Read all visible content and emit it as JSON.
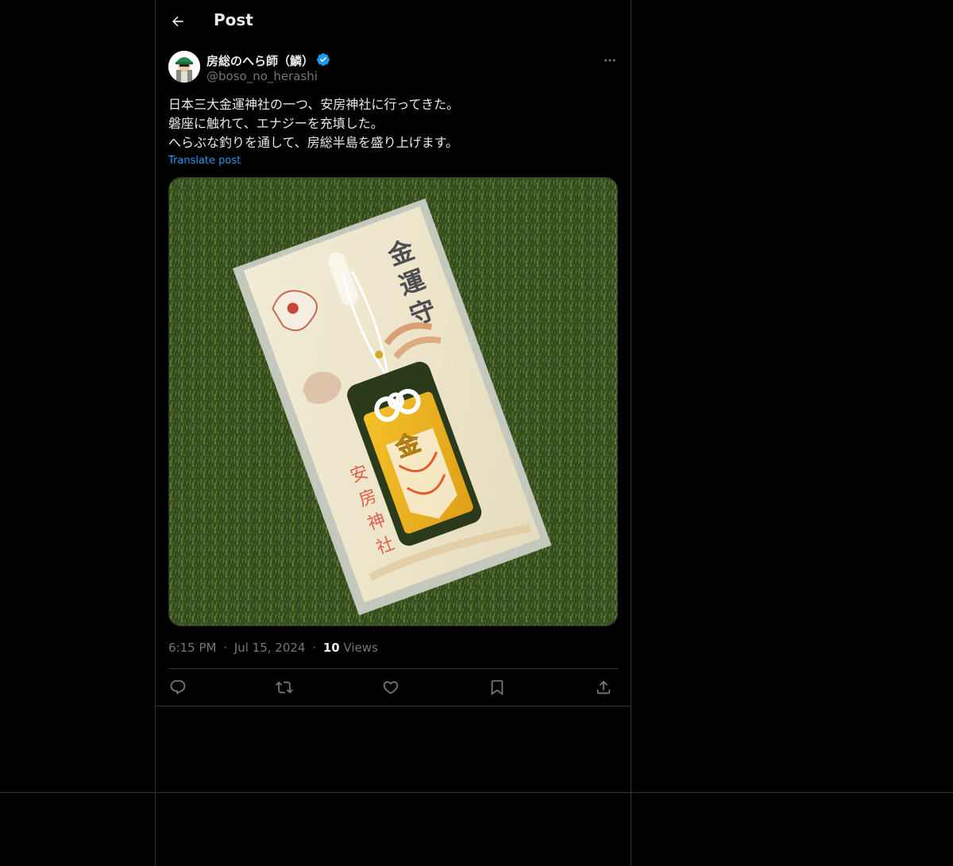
{
  "header": {
    "title": "Post"
  },
  "author": {
    "display_name": "房総のへら師（鱗）",
    "handle": "@boso_no_herashi",
    "verified": true
  },
  "post": {
    "lines": [
      "日本三大金運神社の一つ、安房神社に行ってきた。",
      "磐座に触れて、エナジーを充填した。",
      "へらぶな釣りを通して、房総半島を盛り上げます。"
    ],
    "translate_label": "Translate post",
    "image": {
      "package_text_vertical": "金運守",
      "shrine_name_vertical": "安房神社",
      "amulet_character": "金"
    }
  },
  "meta": {
    "time": "6:15 PM",
    "separator": "·",
    "date": "Jul 15, 2024",
    "views_count": "10",
    "views_label": "Views"
  },
  "actions": [
    {
      "name": "reply",
      "icon": "reply-icon"
    },
    {
      "name": "repost",
      "icon": "repost-icon"
    },
    {
      "name": "like",
      "icon": "heart-icon"
    },
    {
      "name": "bookmark",
      "icon": "bookmark-icon"
    },
    {
      "name": "share",
      "icon": "share-icon"
    }
  ],
  "colors": {
    "background": "#000000",
    "text": "#e7e9ea",
    "muted": "#71767b",
    "accent": "#1d9bf0",
    "border": "#2f3336"
  }
}
